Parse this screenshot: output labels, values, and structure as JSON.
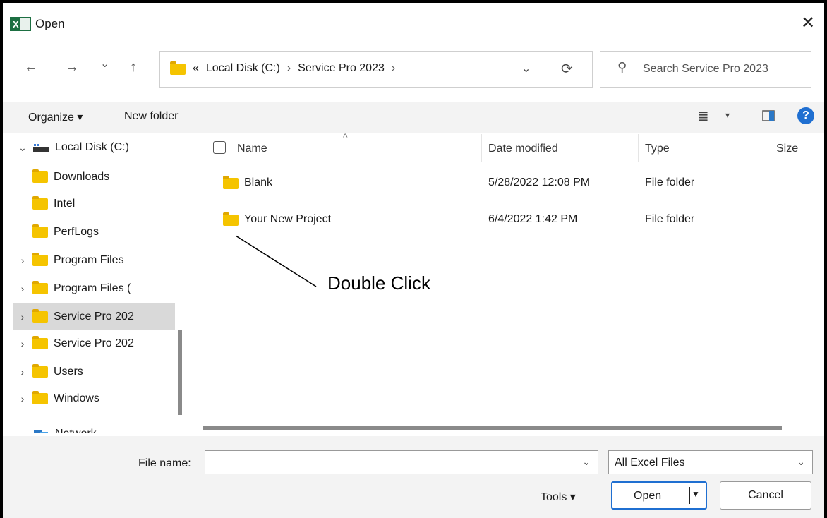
{
  "window": {
    "title": "Open",
    "app_icon_text": "X"
  },
  "nav": {
    "back": "←",
    "forward": "→",
    "recent": "⌄",
    "up": "↑"
  },
  "address": {
    "overflow": "«",
    "crumbs": [
      "Local Disk (C:)",
      "Service Pro 2023"
    ],
    "sep": "›",
    "dropdown": "⌄",
    "refresh": "⟳"
  },
  "search": {
    "placeholder": "Search Service Pro 2023"
  },
  "toolbar": {
    "organize": "Organize ▾",
    "new_folder": "New folder",
    "view_icon": "≣",
    "view_dd": "▾"
  },
  "sidebar": {
    "items": [
      {
        "label": "Local Disk (C:)",
        "chev": "⌄"
      },
      {
        "label": "Downloads",
        "chev": ""
      },
      {
        "label": "Intel",
        "chev": ""
      },
      {
        "label": "PerfLogs",
        "chev": ""
      },
      {
        "label": "Program Files",
        "chev": "›"
      },
      {
        "label": "Program Files (",
        "chev": "›"
      },
      {
        "label": "Service Pro 202",
        "chev": "›"
      },
      {
        "label": "Service Pro 202",
        "chev": "›"
      },
      {
        "label": "Users",
        "chev": "›"
      },
      {
        "label": "Windows",
        "chev": "›"
      },
      {
        "label": "Network",
        "chev": "›"
      }
    ]
  },
  "columns": {
    "name": "Name",
    "date": "Date modified",
    "type": "Type",
    "size": "Size",
    "sort": "^"
  },
  "files": [
    {
      "name": "Blank",
      "date": "5/28/2022 12:08 PM",
      "type": "File folder"
    },
    {
      "name": "Your New Project",
      "date": "6/4/2022 1:42 PM",
      "type": "File folder"
    }
  ],
  "annotation": {
    "text": "Double Click"
  },
  "footer": {
    "file_name_label": "File name:",
    "file_name_value": "",
    "filter": "All Excel Files",
    "tools": "Tools  ▾",
    "open": "Open",
    "cancel": "Cancel"
  }
}
